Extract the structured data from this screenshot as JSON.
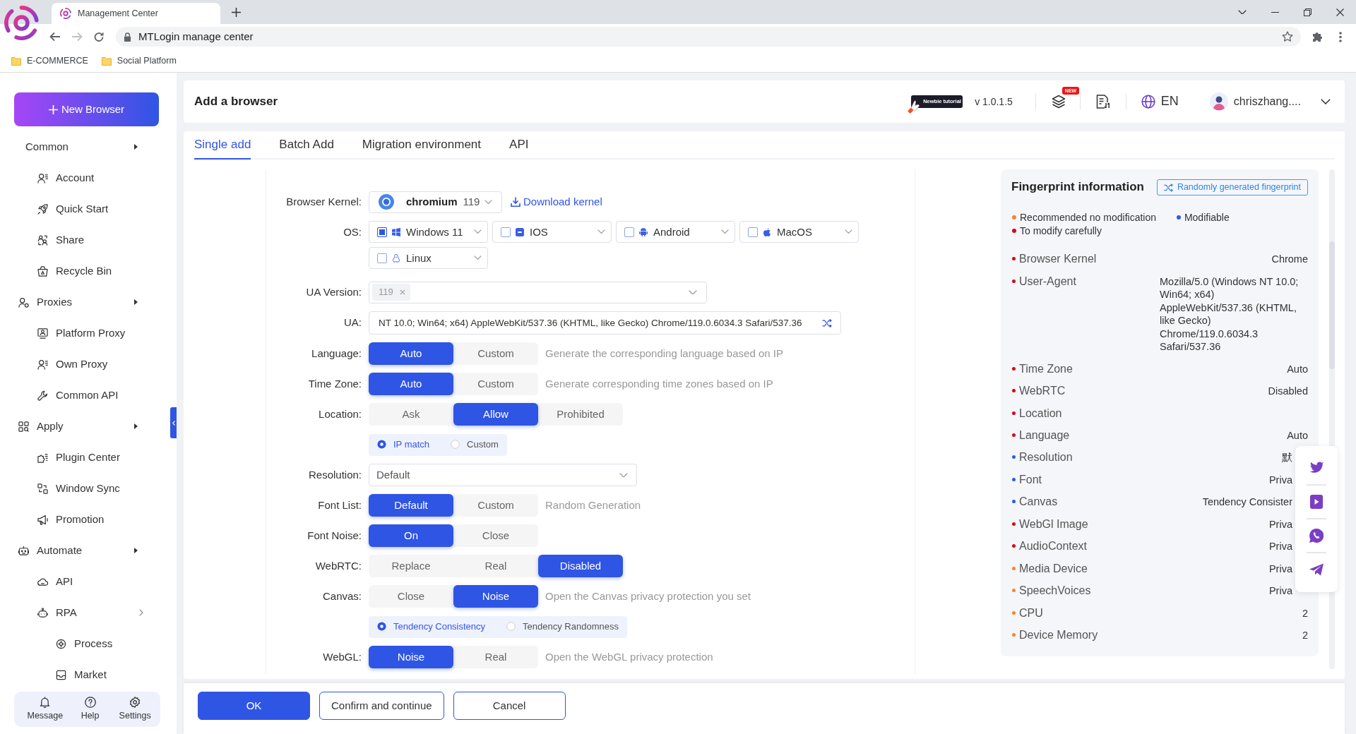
{
  "browser": {
    "tab_title": "Management Center",
    "nav": [
      {
        "kind": "back",
        "disabled": false
      },
      {
        "kind": "forward",
        "disabled": true
      },
      {
        "kind": "reload",
        "disabled": false
      }
    ],
    "address": "MTLogin manage center",
    "bookmarks": [
      {
        "label": "E-COMMERCE"
      },
      {
        "label": "Social Platform"
      }
    ]
  },
  "sidebar": {
    "new_button": "New Browser",
    "menu": [
      {
        "label": "Common",
        "children": [
          {
            "label": "Account"
          },
          {
            "label": "Quick Start"
          },
          {
            "label": "Share"
          },
          {
            "label": "Recycle Bin"
          }
        ]
      },
      {
        "label": "Proxies",
        "children": [
          {
            "label": "Platform Proxy"
          },
          {
            "label": "Own Proxy"
          },
          {
            "label": "Common API"
          }
        ]
      },
      {
        "label": "Apply",
        "children": [
          {
            "label": "Plugin Center"
          },
          {
            "label": "Window Sync"
          },
          {
            "label": "Promotion"
          }
        ]
      },
      {
        "label": "Automate",
        "children": [
          {
            "label": "API"
          },
          {
            "label": "RPA",
            "children": [
              {
                "label": "Process"
              },
              {
                "label": "Market"
              }
            ]
          }
        ]
      }
    ],
    "bottom_bar": [
      {
        "label": "Message"
      },
      {
        "label": "Help"
      },
      {
        "label": "Settings"
      }
    ]
  },
  "header": {
    "title": "Add a browser",
    "tutorial_badge": "Newbie tutorial",
    "version": "v 1.0.1.5",
    "new_badge": "NEW",
    "language": "EN",
    "user": "chriszhang...."
  },
  "tabs": [
    {
      "label": "Single add",
      "selected": true
    },
    {
      "label": "Batch Add",
      "selected": false
    },
    {
      "label": "Migration environment",
      "selected": false
    },
    {
      "label": "API",
      "selected": false
    }
  ],
  "form": [
    {
      "kind": "kernel",
      "label": "Browser Kernel:",
      "value": "chromium",
      "version": "119",
      "link": "Download kernel"
    },
    {
      "kind": "os",
      "label": "OS:",
      "options": [
        {
          "name": "Windows 11",
          "checked": true
        },
        {
          "name": "IOS",
          "checked": false
        },
        {
          "name": "Android",
          "checked": false
        },
        {
          "name": "MacOS",
          "checked": false
        },
        {
          "name": "Linux",
          "checked": false
        }
      ]
    },
    {
      "kind": "tag_select",
      "label": "UA Version:",
      "tags": [
        "119"
      ]
    },
    {
      "kind": "text_input",
      "label": "UA:",
      "value": "NT 10.0; Win64; x64) AppleWebKit/537.36 (KHTML, like Gecko) Chrome/119.0.6034.3 Safari/537.36"
    },
    {
      "kind": "segmented",
      "label": "Language:",
      "options": [
        {
          "label": "Auto",
          "selected": true
        },
        {
          "label": "Custom",
          "selected": false
        }
      ],
      "hint": "Generate the corresponding language based on IP"
    },
    {
      "kind": "segmented",
      "label": "Time Zone:",
      "options": [
        {
          "label": "Auto",
          "selected": true
        },
        {
          "label": "Custom",
          "selected": false
        }
      ],
      "hint": "Generate corresponding time zones based on IP"
    },
    {
      "kind": "segmented",
      "label": "Location:",
      "options": [
        {
          "label": "Ask",
          "selected": false
        },
        {
          "label": "Allow",
          "selected": true
        },
        {
          "label": "Prohibited",
          "selected": false
        }
      ]
    },
    {
      "kind": "radio_group",
      "options": [
        {
          "label": "IP match",
          "selected": true
        },
        {
          "label": "Custom",
          "selected": false
        }
      ]
    },
    {
      "kind": "select",
      "label": "Resolution:",
      "value": "Default"
    },
    {
      "kind": "segmented",
      "label": "Font List:",
      "options": [
        {
          "label": "Default",
          "selected": true
        },
        {
          "label": "Custom",
          "selected": false
        }
      ],
      "hint": "Random Generation"
    },
    {
      "kind": "segmented",
      "label": "Font Noise:",
      "options": [
        {
          "label": "On",
          "selected": true
        },
        {
          "label": "Close",
          "selected": false
        }
      ]
    },
    {
      "kind": "segmented",
      "label": "WebRTC:",
      "options": [
        {
          "label": "Replace",
          "selected": false
        },
        {
          "label": "Real",
          "selected": false
        },
        {
          "label": "Disabled",
          "selected": true
        }
      ]
    },
    {
      "kind": "segmented",
      "label": "Canvas:",
      "options": [
        {
          "label": "Close",
          "selected": false
        },
        {
          "label": "Noise",
          "selected": true
        }
      ],
      "hint": "Open the Canvas privacy protection you set"
    },
    {
      "kind": "radio_group",
      "options": [
        {
          "label": "Tendency Consistency",
          "selected": true
        },
        {
          "label": "Tendency Randomness",
          "selected": false
        }
      ]
    },
    {
      "kind": "segmented",
      "label": "WebGL:",
      "options": [
        {
          "label": "Noise",
          "selected": true
        },
        {
          "label": "Real",
          "selected": false
        }
      ],
      "hint": "Open the WebGL privacy protection"
    }
  ],
  "fingerprint": {
    "title": "Fingerprint information",
    "random_button": "Randomly generated fingerprint",
    "legend": [
      {
        "label": "Recommended no modification",
        "color": "#f7852a"
      },
      {
        "label": "Modifiable",
        "color": "#2f5ae8"
      },
      {
        "label": "To modify carefully",
        "color": "#d9001b"
      }
    ],
    "rows": [
      {
        "name": "Browser Kernel",
        "value": "Chrome",
        "color": "#d9001b"
      },
      {
        "name": "User-Agent",
        "value": "Mozilla/5.0 (Windows NT 10.0; Win64; x64) AppleWebKit/537.36 (KHTML, like Gecko) Chrome/119.0.6034.3 Safari/537.36",
        "color": "#d9001b"
      },
      {
        "name": "Time Zone",
        "value": "Auto",
        "color": "#d9001b"
      },
      {
        "name": "WebRTC",
        "value": "Disabled",
        "color": "#d9001b"
      },
      {
        "name": "Location",
        "color": "#d9001b"
      },
      {
        "name": "Language",
        "value": "Auto",
        "color": "#d9001b"
      },
      {
        "name": "Resolution",
        "value": "默",
        "color": "#2f5ae8"
      },
      {
        "name": "Font",
        "value": "Priva",
        "color": "#2f5ae8"
      },
      {
        "name": "Canvas",
        "value": "Tendency Consister",
        "color": "#2f5ae8"
      },
      {
        "name": "WebGl Image",
        "value": "Priva",
        "color": "#d9001b"
      },
      {
        "name": "AudioContext",
        "value": "Priva",
        "color": "#d9001b"
      },
      {
        "name": "Media Device",
        "value": "Priva",
        "color": "#f7852a"
      },
      {
        "name": "SpeechVoices",
        "value": "Priva",
        "color": "#f7852a"
      },
      {
        "name": "CPU",
        "value": "2",
        "color": "#f7852a"
      },
      {
        "name": "Device Memory",
        "value": "2",
        "color": "#f7852a"
      }
    ]
  },
  "footer_buttons": [
    {
      "label": "OK",
      "kind": "primary"
    },
    {
      "label": "Confirm and continue",
      "kind": "outline"
    },
    {
      "label": "Cancel",
      "kind": "outline"
    }
  ]
}
